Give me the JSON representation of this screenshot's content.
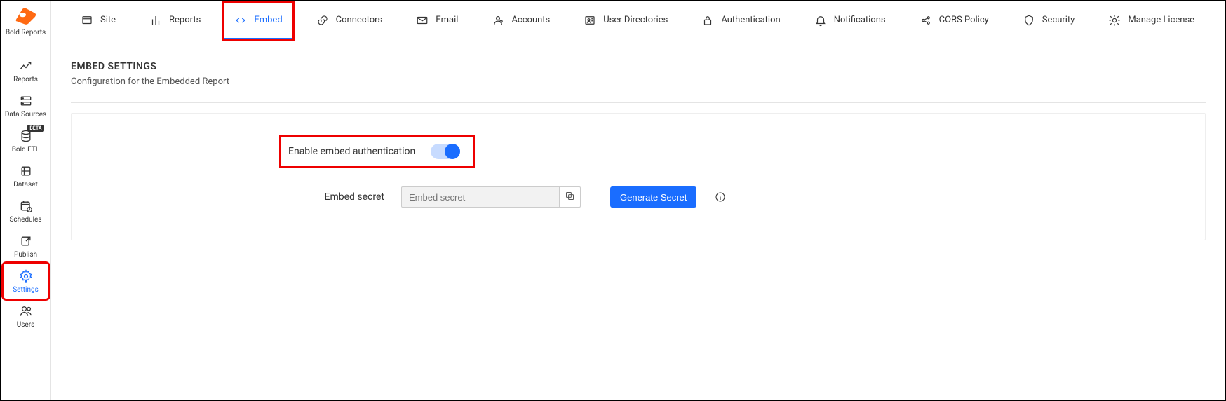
{
  "brand": "Bold Reports",
  "sidebar": {
    "items": [
      {
        "label": "Reports",
        "icon": "chart-line"
      },
      {
        "label": "Data Sources",
        "icon": "server"
      },
      {
        "label": "Bold ETL",
        "icon": "database",
        "beta": "BETA"
      },
      {
        "label": "Dataset",
        "icon": "dataset"
      },
      {
        "label": "Schedules",
        "icon": "calendar-clock"
      },
      {
        "label": "Publish",
        "icon": "share"
      },
      {
        "label": "Settings",
        "icon": "gear",
        "active": true
      },
      {
        "label": "Users",
        "icon": "users"
      }
    ]
  },
  "tabs": [
    {
      "label": "Site",
      "icon": "site"
    },
    {
      "label": "Reports",
      "icon": "bars"
    },
    {
      "label": "Embed",
      "icon": "code",
      "active": true
    },
    {
      "label": "Connectors",
      "icon": "link"
    },
    {
      "label": "Email",
      "icon": "mail"
    },
    {
      "label": "Accounts",
      "icon": "account"
    },
    {
      "label": "User Directories",
      "icon": "directory"
    },
    {
      "label": "Authentication",
      "icon": "lock"
    },
    {
      "label": "Notifications",
      "icon": "bell"
    },
    {
      "label": "CORS Policy",
      "icon": "cors"
    },
    {
      "label": "Security",
      "icon": "shield"
    },
    {
      "label": "Manage License",
      "icon": "license"
    }
  ],
  "page": {
    "title": "EMBED SETTINGS",
    "subtitle": "Configuration for the Embedded Report"
  },
  "embed": {
    "enable_label": "Enable embed authentication",
    "enable_value": true,
    "secret_label": "Embed secret",
    "secret_placeholder": "Embed secret",
    "secret_value": "",
    "generate_label": "Generate Secret"
  }
}
